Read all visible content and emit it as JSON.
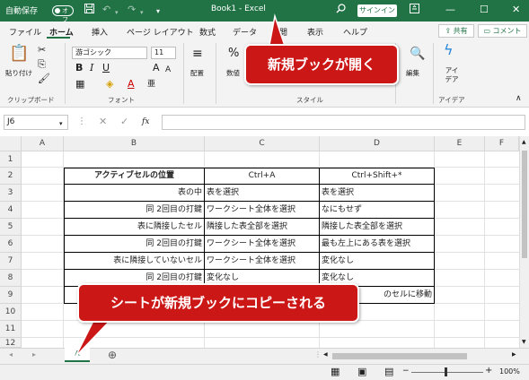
{
  "titlebar": {
    "autosave_label": "自動保存",
    "autosave_state": "オフ",
    "window_title": "Book1 - Excel",
    "signin_label": "サインイン",
    "min_glyph": "—",
    "max_glyph": "☐",
    "close_glyph": "✕"
  },
  "ribbon_tabs": [
    "ファイル",
    "ホーム",
    "挿入",
    "ページ レイアウト",
    "数式",
    "データ",
    "校閲",
    "表示",
    "ヘルプ"
  ],
  "share_label": "共有",
  "comment_label": "コメント",
  "ribbon": {
    "paste_label": "貼り付け",
    "clipboard_group": "クリップボード",
    "font_name": "游ゴシック",
    "font_size": "11",
    "font_group": "フォント",
    "align_label": "配置",
    "number_label": "数値",
    "style_group": "スタイル",
    "edit_label": "編集",
    "idea_label": "アイデア",
    "idea_group": "アイデア"
  },
  "formula_bar": {
    "name_box": "J6",
    "cancel": "✕",
    "enter": "✓",
    "fx": "fx"
  },
  "columns": [
    "A",
    "B",
    "C",
    "D",
    "E",
    "F"
  ],
  "rows": [
    "1",
    "2",
    "3",
    "4",
    "5",
    "6",
    "7",
    "8",
    "9",
    "10",
    "11",
    "12"
  ],
  "table": {
    "header": [
      "アクティブセルの位置",
      "Ctrl+A",
      "Ctrl+Shift+*"
    ],
    "rows": [
      [
        "表の中",
        "表を選択",
        "表を選択"
      ],
      [
        "同 2回目の打鍵",
        "ワークシート全体を選択",
        "なにもせず"
      ],
      [
        "表に隣接したセル",
        "隣接した表全部を選択",
        "隣接した表全部を選択"
      ],
      [
        "同 2回目の打鍵",
        "ワークシート全体を選択",
        "最も左上にある表を選択"
      ],
      [
        "表に隣接していないセル",
        "ワークシート全体を選択",
        "変化なし"
      ],
      [
        "同 2回目の打鍵",
        "変化なし",
        "変化なし"
      ],
      [
        "",
        "",
        "のセルに移動"
      ]
    ]
  },
  "sheet_tab": "A",
  "add_sheet": "⊕",
  "zoom": "100%",
  "callouts": {
    "top": "新規ブックが開く",
    "bottom": "シートが新規ブックにコピーされる"
  },
  "colors": {
    "excel_green": "#217346",
    "callout_red": "#cc1717"
  }
}
